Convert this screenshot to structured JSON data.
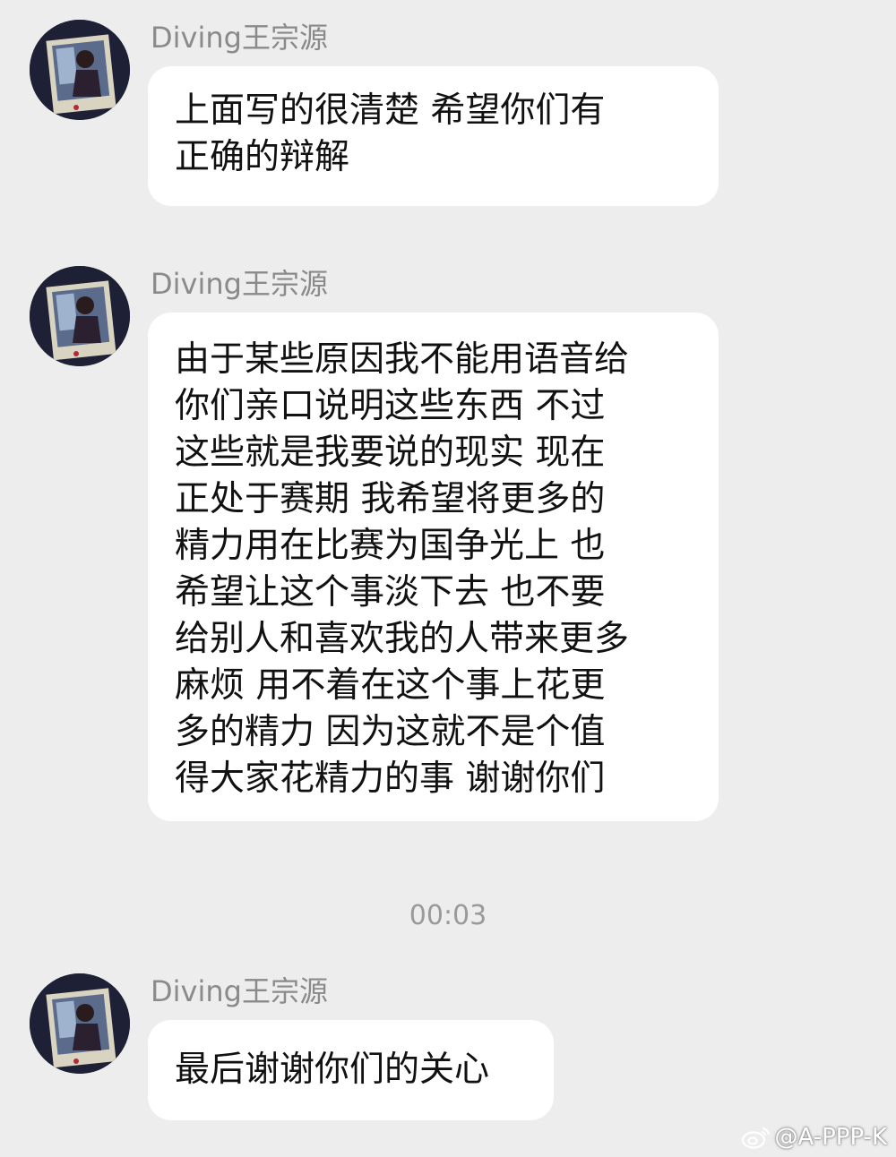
{
  "messages": [
    {
      "sender": "Diving王宗源",
      "text": "上面写的很清楚 希望你们有\n正确的辩解"
    },
    {
      "sender": "Diving王宗源",
      "text": "由于某些原因我不能用语音给\n你们亲口说明这些东西 不过\n这些就是我要说的现实 现在\n正处于赛期 我希望将更多的\n精力用在比赛为国争光上 也\n希望让这个事淡下去 也不要\n给别人和喜欢我的人带来更多\n麻烦 用不着在这个事上花更\n多的精力 因为这就不是个值\n得大家花精力的事 谢谢你们"
    },
    {
      "sender": "Diving王宗源",
      "text": "最后谢谢你们的关心"
    }
  ],
  "timestamp": "00:03",
  "watermark": {
    "icon": "weibo-logo-icon",
    "handle": "@A-PPP-K"
  },
  "colors": {
    "background": "#ededed",
    "bubble": "#ffffff",
    "sender": "#8a8a8a",
    "text": "#111111"
  }
}
